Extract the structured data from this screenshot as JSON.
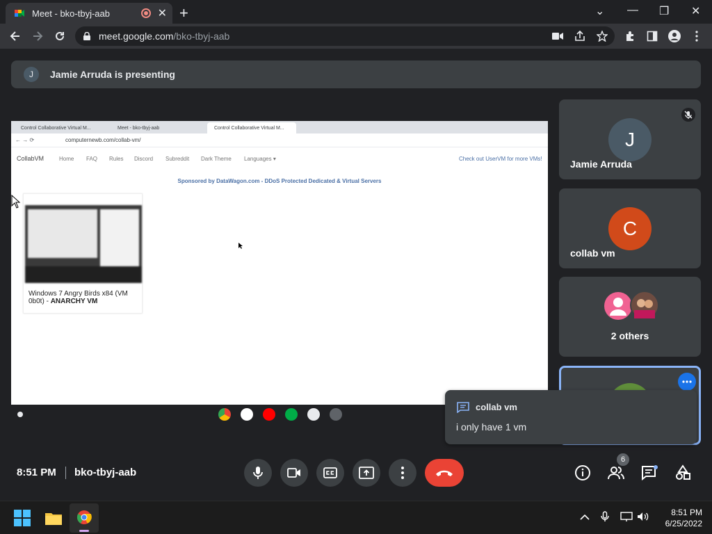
{
  "browser": {
    "tab_title": "Meet - bko-tbyj-aab",
    "tab_close": "✕",
    "new_tab": "+",
    "window_controls": {
      "dropdown": "⌄",
      "minimize": "—",
      "restore": "❐",
      "close": "✕"
    },
    "url_host": "meet.google.com",
    "url_path": "/bko-tbyj-aab"
  },
  "meet": {
    "presenter_initial": "J",
    "presenting_text": "Jamie Arruda is presenting",
    "time": "8:51 PM",
    "meeting_code": "bko-tbyj-aab",
    "people_count": "6"
  },
  "shared_screen": {
    "tabs": [
      "Control Collaborative Virtual M...",
      "Meet - bko-tbyj-aab",
      "Control Collaborative Virtual M..."
    ],
    "url": "computernewb.com/collab-vm/",
    "nav_brand": "CollabVM",
    "nav_links": [
      "Home",
      "FAQ",
      "Rules",
      "Discord",
      "Subreddit",
      "Dark Theme",
      "Languages ▾"
    ],
    "nav_right": "Check out UserVM for more VMs!",
    "sponsor": "Sponsored by DataWagon.com - DDoS Protected Dedicated & Virtual Servers",
    "vm_caption": "Windows 7 Angry Birds x84 (VM 0b0t) - ",
    "vm_caption_bold": "ANARCHY VM"
  },
  "participants": [
    {
      "initial": "J",
      "name": "Jamie Arruda",
      "color": "#4a5a66"
    },
    {
      "initial": "C",
      "name": "collab vm",
      "color": "#d14a1a"
    },
    {
      "name": "2 others"
    }
  ],
  "chat_toast": {
    "from": "collab vm",
    "message": "i only have 1 vm"
  },
  "taskbar": {
    "time": "8:51 PM",
    "date": "6/25/2022"
  },
  "colors": {
    "end_call": "#ea4335",
    "accent_blue": "#8ab4f8",
    "surface": "#3c4043",
    "background": "#202124"
  }
}
